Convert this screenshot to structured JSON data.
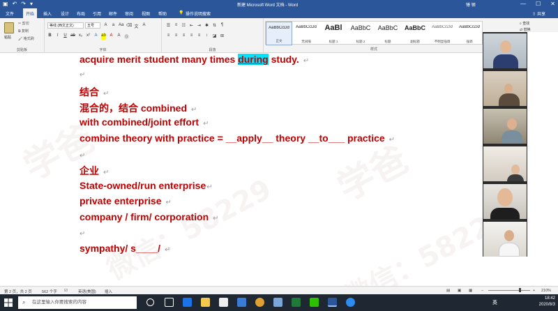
{
  "titlebar": {
    "doc_title": "新建 Microsoft Word 文档 - Word",
    "user": "锤 钢",
    "min": "—",
    "max": "☐",
    "close": "✕"
  },
  "tabs": [
    {
      "label": "文件"
    },
    {
      "label": "开始"
    },
    {
      "label": "插入"
    },
    {
      "label": "设计"
    },
    {
      "label": "布局"
    },
    {
      "label": "引用"
    },
    {
      "label": "邮件"
    },
    {
      "label": "审阅"
    },
    {
      "label": "视图"
    },
    {
      "label": "帮助"
    },
    {
      "label": "操作说明搜索"
    }
  ],
  "share_label": "共享",
  "ribbon": {
    "paste_label": "粘贴",
    "cut": "剪切",
    "copy": "复制",
    "format_painter": "格式刷",
    "clipboard_label": "剪贴板",
    "font_name": "等线 (西文正文)",
    "font_size": "五号",
    "font_label": "字体",
    "paragraph_label": "段落",
    "styles_label": "样式",
    "find": "查找",
    "replace": "替换",
    "select": "选择"
  },
  "styles": [
    {
      "sample": "AaBbCcDd",
      "name": "正文"
    },
    {
      "sample": "AaBbCcDd",
      "name": "无间隔"
    },
    {
      "sample": "AaBl",
      "name": "标题 1"
    },
    {
      "sample": "AaBbC",
      "name": "标题 2"
    },
    {
      "sample": "AaBbC",
      "name": "标题"
    },
    {
      "sample": "AaBbC",
      "name": "副标题"
    },
    {
      "sample": "AaBbCcDd",
      "name": "不明显强调"
    },
    {
      "sample": "AaBbCcDd",
      "name": "强调"
    }
  ],
  "document": {
    "line1_pre": "acquire merit student many times ",
    "line1_hl": "during",
    "line1_post": " study.",
    "line3": "结合",
    "line4": "混合的，结合  combined",
    "line5": "with combined/joint effort",
    "line6": "combine theory with practice = __apply__ theory __to___ practice",
    "line8": "企业",
    "line9": "State-owned/run enterprise",
    "line10": "private enterprise",
    "line11": "company / firm/ corporation",
    "line13": "sympathy/ s____/",
    "para_mark": "↵"
  },
  "watermarks": [
    {
      "text": "学爸"
    },
    {
      "text": "学爸"
    },
    {
      "text": "微信：58229"
    },
    {
      "text": "微信：58229"
    }
  ],
  "statusbar": {
    "page": "第 2 页，共 2 页",
    "words": "562 个字",
    "lang": "英语(美国)",
    "mode": "插入",
    "zoom": "210%"
  },
  "taskbar": {
    "search_placeholder": "在这里输入你要搜索的内容",
    "lang": "英",
    "time": "18:42",
    "date": "2020/8/3"
  }
}
